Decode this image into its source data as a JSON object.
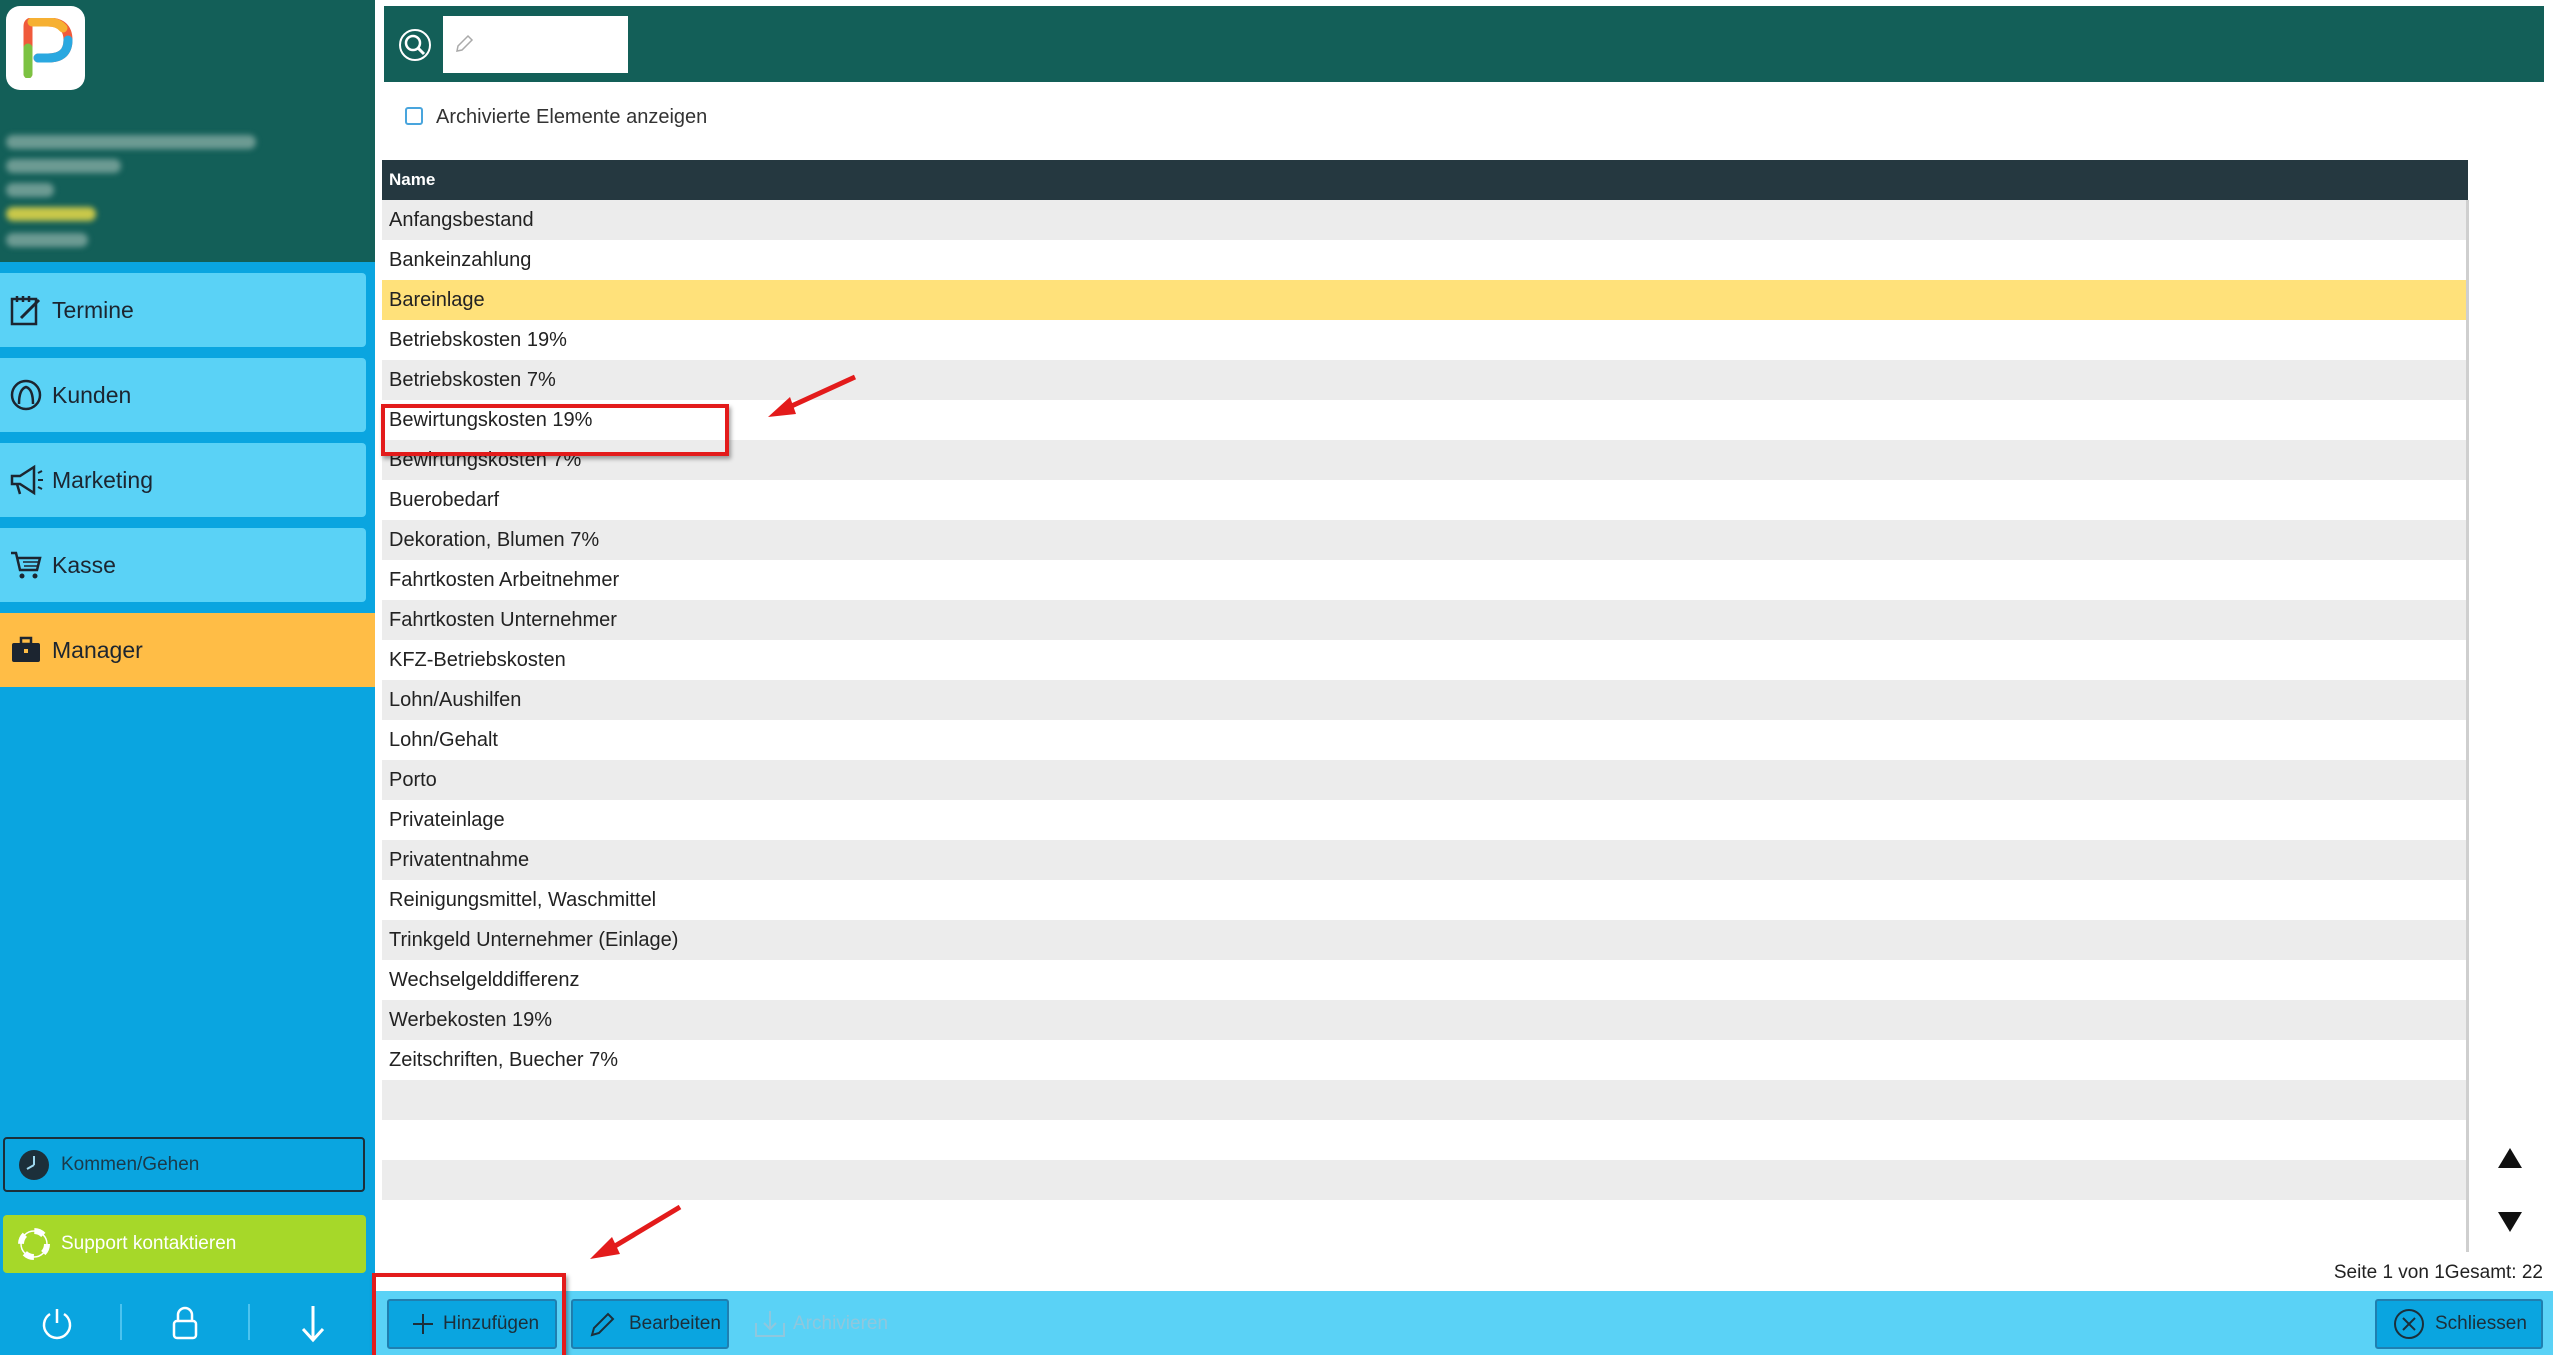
{
  "sidebar": {
    "nav": [
      {
        "label": "Termine",
        "icon": "calendar-edit-icon"
      },
      {
        "label": "Kunden",
        "icon": "customer-icon"
      },
      {
        "label": "Marketing",
        "icon": "megaphone-icon"
      },
      {
        "label": "Kasse",
        "icon": "cart-icon"
      },
      {
        "label": "Manager",
        "icon": "briefcase-icon"
      }
    ],
    "kommen_gehen": "Kommen/Gehen",
    "support": "Support kontaktieren"
  },
  "search": {
    "placeholder": ""
  },
  "archive_toggle": {
    "label": "Archivierte Elemente anzeigen",
    "checked": false
  },
  "table": {
    "header": "Name",
    "rows": [
      "Anfangsbestand",
      "Bankeinzahlung",
      "Bareinlage",
      "Betriebskosten 19%",
      "Betriebskosten 7%",
      "Bewirtungskosten 19%",
      "Bewirtungskosten 7%",
      "Buerobedarf",
      "Dekoration, Blumen 7%",
      "Fahrtkosten Arbeitnehmer",
      "Fahrtkosten Unternehmer",
      "KFZ-Betriebskosten",
      "Lohn/Aushilfen",
      "Lohn/Gehalt",
      "Porto",
      "Privateinlage",
      "Privatentnahme",
      "Reinigungsmittel, Waschmittel",
      "Trinkgeld Unternehmer (Einlage)",
      "Wechselgelddifferenz",
      "Werbekosten 19%",
      "Zeitschriften, Buecher 7%"
    ],
    "selected_row": "Bareinlage"
  },
  "pagination": {
    "text": "Seite 1 von 1Gesamt: 22"
  },
  "buttons": {
    "add": "Hinzufügen",
    "edit": "Bearbeiten",
    "archive": "Archivieren",
    "close": "Schliessen"
  },
  "colors": {
    "sidebar": "#0aa5e0",
    "header_green": "#135f58",
    "nav_item": "#5ad2f6",
    "nav_active": "#ffbd46",
    "selected_row": "#ffe17a",
    "annotation": "#e31b1b"
  }
}
